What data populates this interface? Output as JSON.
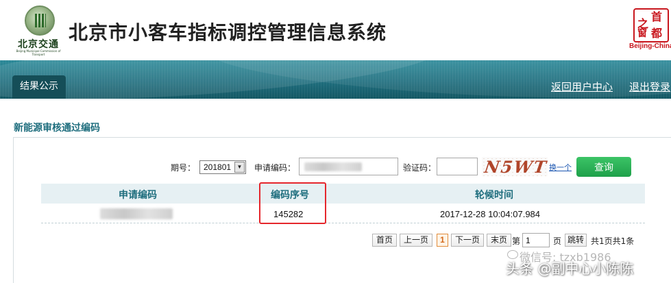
{
  "header": {
    "logo_brand": "北京交通",
    "logo_subtext": "Beijing Municipal Commission of Transport",
    "title": "北京市小客车指标调控管理信息系统",
    "right_logo_chars": [
      "首",
      "都",
      "之",
      "窗"
    ],
    "right_logo_caption": "Beijing-China"
  },
  "nav": {
    "active_tab": "结果公示",
    "links": [
      "返回用户中心",
      "退出登录"
    ]
  },
  "section": {
    "title": "新能源审核通过编码"
  },
  "search": {
    "period_label": "期号：",
    "period_value": "201801",
    "code_label": "申请编码：",
    "code_value": "",
    "captcha_label": "验证码：",
    "captcha_value": "",
    "captcha_text": "N5WT",
    "refresh_label": "换一个",
    "query_button": "查询"
  },
  "table": {
    "columns": [
      "申请编码",
      "编码序号",
      "轮候时间"
    ],
    "rows": [
      {
        "code": "",
        "serial": "145282",
        "time": "2017-12-28 10:04:07.984"
      }
    ]
  },
  "pagination": {
    "first": "首页",
    "prev": "上一页",
    "current": "1",
    "next": "下一页",
    "last": "末页",
    "goto_prefix": "第",
    "goto_value": "1",
    "goto_suffix": "页",
    "jump": "跳转",
    "summary": "共1页共1条"
  },
  "watermark": {
    "wechat": "微信号: tzxb1986",
    "author": "头条 @副中心小陈陈"
  },
  "colors": {
    "banner": "#1f6e7e",
    "section_text": "#1f6e7e",
    "query_button": "#1ea04a",
    "highlight_box": "#e5262c",
    "seal": "#c8161d"
  }
}
